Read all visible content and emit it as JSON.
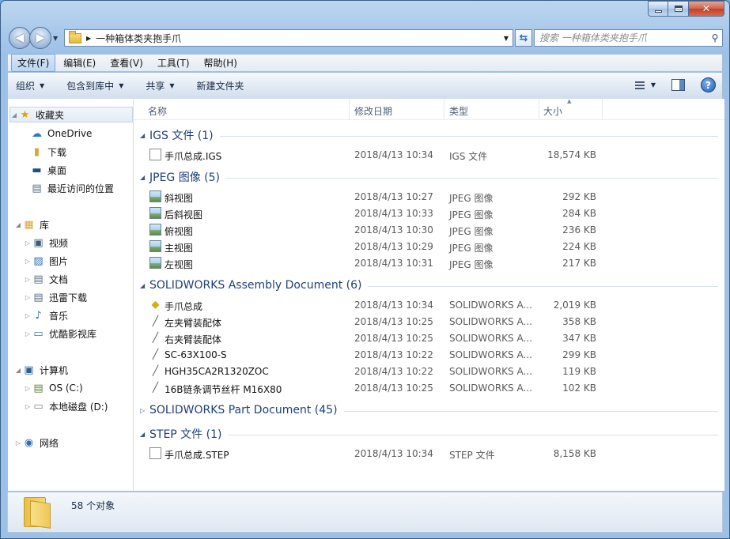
{
  "window": {
    "address_path": "一种箱体类夹抱手爪",
    "search_placeholder": "搜索 一种箱体类夹抱手爪"
  },
  "menu": [
    "文件(F)",
    "编辑(E)",
    "查看(V)",
    "工具(T)",
    "帮助(H)"
  ],
  "toolbar": {
    "organize": "组织",
    "include_in_library": "包含到库中",
    "share": "共享",
    "new_folder": "新建文件夹"
  },
  "sidebar": {
    "favorites": "收藏夹",
    "onedrive": "OneDrive",
    "downloads": "下载",
    "desktop": "桌面",
    "recent": "最近访问的位置",
    "libraries": "库",
    "videos": "视频",
    "pictures": "图片",
    "documents": "文档",
    "thunder": "迅雷下载",
    "music": "音乐",
    "youku": "优酷影视库",
    "computer": "计算机",
    "os_c": "OS (C:)",
    "local_d": "本地磁盘 (D:)",
    "network": "网络"
  },
  "columns": {
    "name": "名称",
    "date": "修改日期",
    "type": "类型",
    "size": "大小"
  },
  "groups": [
    {
      "title": "IGS 文件 (1)",
      "expanded": true,
      "icon": "doc",
      "files": [
        {
          "name": "手爪总成.IGS",
          "date": "2018/4/13 10:34",
          "type": "IGS 文件",
          "size": "18,574 KB"
        }
      ]
    },
    {
      "title": "JPEG 图像 (5)",
      "expanded": true,
      "icon": "image",
      "files": [
        {
          "name": "斜视图",
          "date": "2018/4/13 10:27",
          "type": "JPEG 图像",
          "size": "292 KB"
        },
        {
          "name": "后斜视图",
          "date": "2018/4/13 10:33",
          "type": "JPEG 图像",
          "size": "284 KB"
        },
        {
          "name": "俯视图",
          "date": "2018/4/13 10:30",
          "type": "JPEG 图像",
          "size": "236 KB"
        },
        {
          "name": "主视图",
          "date": "2018/4/13 10:29",
          "type": "JPEG 图像",
          "size": "224 KB"
        },
        {
          "name": "左视图",
          "date": "2018/4/13 10:31",
          "type": "JPEG 图像",
          "size": "217 KB"
        }
      ]
    },
    {
      "title": "SOLIDWORKS Assembly Document (6)",
      "expanded": true,
      "icon": "assembly",
      "files": [
        {
          "name": "手爪总成",
          "date": "2018/4/13 10:34",
          "type": "SOLIDWORKS A...",
          "size": "2,019 KB"
        },
        {
          "name": "左夹臂装配体",
          "date": "2018/4/13 10:25",
          "type": "SOLIDWORKS A...",
          "size": "358 KB"
        },
        {
          "name": "右夹臂装配体",
          "date": "2018/4/13 10:25",
          "type": "SOLIDWORKS A...",
          "size": "347 KB"
        },
        {
          "name": "SC-63X100-S",
          "date": "2018/4/13 10:22",
          "type": "SOLIDWORKS A...",
          "size": "299 KB"
        },
        {
          "name": "HGH35CA2R1320ZOC",
          "date": "2018/4/13 10:22",
          "type": "SOLIDWORKS A...",
          "size": "119 KB"
        },
        {
          "name": "16B链条调节丝杆 M16X80",
          "date": "2018/4/13 10:25",
          "type": "SOLIDWORKS A...",
          "size": "102 KB"
        }
      ]
    },
    {
      "title": "SOLIDWORKS Part Document (45)",
      "expanded": false,
      "icon": "part",
      "files": []
    },
    {
      "title": "STEP 文件 (1)",
      "expanded": true,
      "icon": "doc",
      "files": [
        {
          "name": "手爪总成.STEP",
          "date": "2018/4/13 10:34",
          "type": "STEP 文件",
          "size": "8,158 KB"
        }
      ]
    }
  ],
  "status": {
    "item_count": "58 个对象"
  },
  "colors": {
    "group_title": "#1e3f7a",
    "frame": "#9cc0e6"
  }
}
